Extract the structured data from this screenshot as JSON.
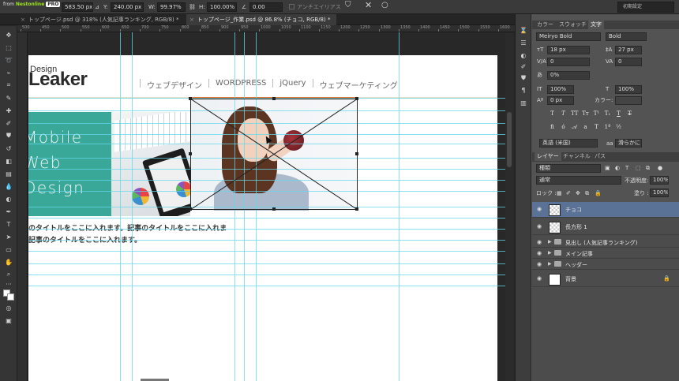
{
  "options_bar": {
    "x_value": "583.50 px",
    "y_label": "Y:",
    "y_value": "240.00 px",
    "w_label": "W:",
    "w_value": "99.97%",
    "h_label": "H:",
    "h_value": "100.00%",
    "angle_value": "0.00",
    "antialias_label": "アンチエイリアス",
    "workspace": "初期設定",
    "watermark_from": "from",
    "watermark_brand": "Nestonline",
    "watermark_pro": "PRO"
  },
  "tabs": [
    {
      "label": "トップページ.psd @ 318% (人気記事ランキング, RGB/8) *"
    },
    {
      "label": "トップページ_作業.psd @ 86.8% (チョコ, RGB/8) *"
    }
  ],
  "rulers": {
    "marks": [
      "500",
      "450",
      "500",
      "550",
      "600",
      "650",
      "700",
      "750",
      "800",
      "850",
      "900",
      "950",
      "1000",
      "1050",
      "1100",
      "1150",
      "1200",
      "1250",
      "1300",
      "1350",
      "1400",
      "1450",
      "1500",
      "1550",
      "1600"
    ]
  },
  "canvas": {
    "logo_top": "Design",
    "logo_main": "Leaker",
    "nav": [
      "ウェブデザイン",
      "WORDPRESS",
      "jQuery",
      "ウェブマーケティング"
    ],
    "banner_lines": [
      "Mobile",
      "Web",
      "Design"
    ],
    "article_line1": "のタイトルをここに入れます。記事のタイトルをここに入れま",
    "article_line2": "記事のタイトルをここに入れます。"
  },
  "char_panel": {
    "tabs": [
      "カラー",
      "スウォッチ",
      "文字"
    ],
    "font_family": "Meiryo Bold",
    "font_style": "Bold",
    "font_size": "18 px",
    "leading": "27 px",
    "kerning": "0",
    "tracking": "0",
    "tsume": "0%",
    "vscale": "100%",
    "hscale": "100%",
    "baseline": "0 px",
    "color_label": "カラー:",
    "language": "英語 (米国)",
    "aa_label": "aa",
    "antialias": "滑らかに"
  },
  "layers_panel": {
    "tabs": [
      "レイヤー",
      "チャンネル",
      "パス"
    ],
    "filter_kind": "種類",
    "blend_mode": "通常",
    "opacity_label": "不透明度:",
    "opacity": "100%",
    "lock_label": "ロック :",
    "fill_label": "塗り :",
    "fill": "100%",
    "layers": [
      {
        "name": "チョコ"
      },
      {
        "name": "長方形 1"
      },
      {
        "name": "見出し (人気記事ランキング)"
      },
      {
        "name": "メイン記事"
      },
      {
        "name": "ヘッダー"
      },
      {
        "name": "背景"
      }
    ]
  },
  "colors": {
    "teal_banner": "#3aa898",
    "guide": "#64d7eb",
    "selected_layer": "#5a7295"
  }
}
